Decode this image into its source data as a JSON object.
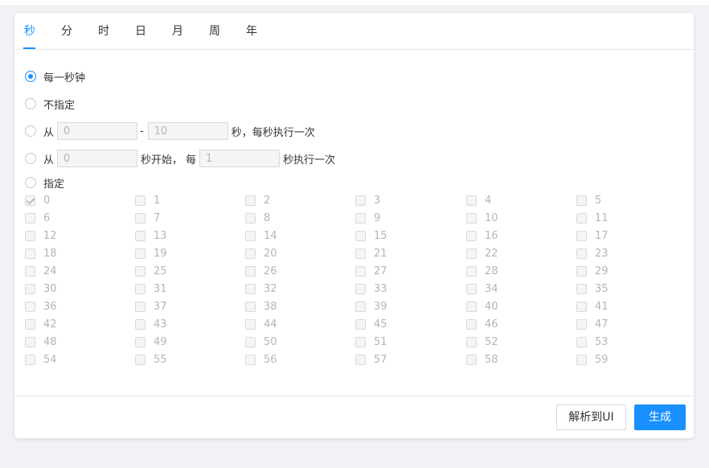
{
  "tabs": [
    "秒",
    "分",
    "时",
    "日",
    "月",
    "周",
    "年"
  ],
  "options": {
    "every": "每一秒钟",
    "unspecified": "不指定",
    "range": {
      "from_label": "从",
      "from_value": "0",
      "dash": "-",
      "to_value": "10",
      "suffix": "秒，每秒执行一次"
    },
    "interval": {
      "from_label": "从",
      "start_value": "0",
      "start_suffix": "秒开始，",
      "every_label": "每",
      "step_value": "1",
      "step_suffix": "秒执行一次"
    },
    "specify": "指定"
  },
  "seconds": [
    "0",
    "1",
    "2",
    "3",
    "4",
    "5",
    "6",
    "7",
    "8",
    "9",
    "10",
    "11",
    "12",
    "13",
    "14",
    "15",
    "16",
    "17",
    "18",
    "19",
    "20",
    "21",
    "22",
    "23",
    "24",
    "25",
    "26",
    "27",
    "28",
    "29",
    "30",
    "31",
    "32",
    "33",
    "34",
    "35",
    "36",
    "37",
    "38",
    "39",
    "40",
    "41",
    "42",
    "43",
    "44",
    "45",
    "46",
    "47",
    "48",
    "49",
    "50",
    "51",
    "52",
    "53",
    "54",
    "55",
    "56",
    "57",
    "58",
    "59"
  ],
  "checked_seconds": [
    "0"
  ],
  "buttons": {
    "parse": "解析到UI",
    "generate": "生成"
  },
  "colors": {
    "accent": "#1890ff",
    "disabled_text": "#b5b5b5"
  }
}
